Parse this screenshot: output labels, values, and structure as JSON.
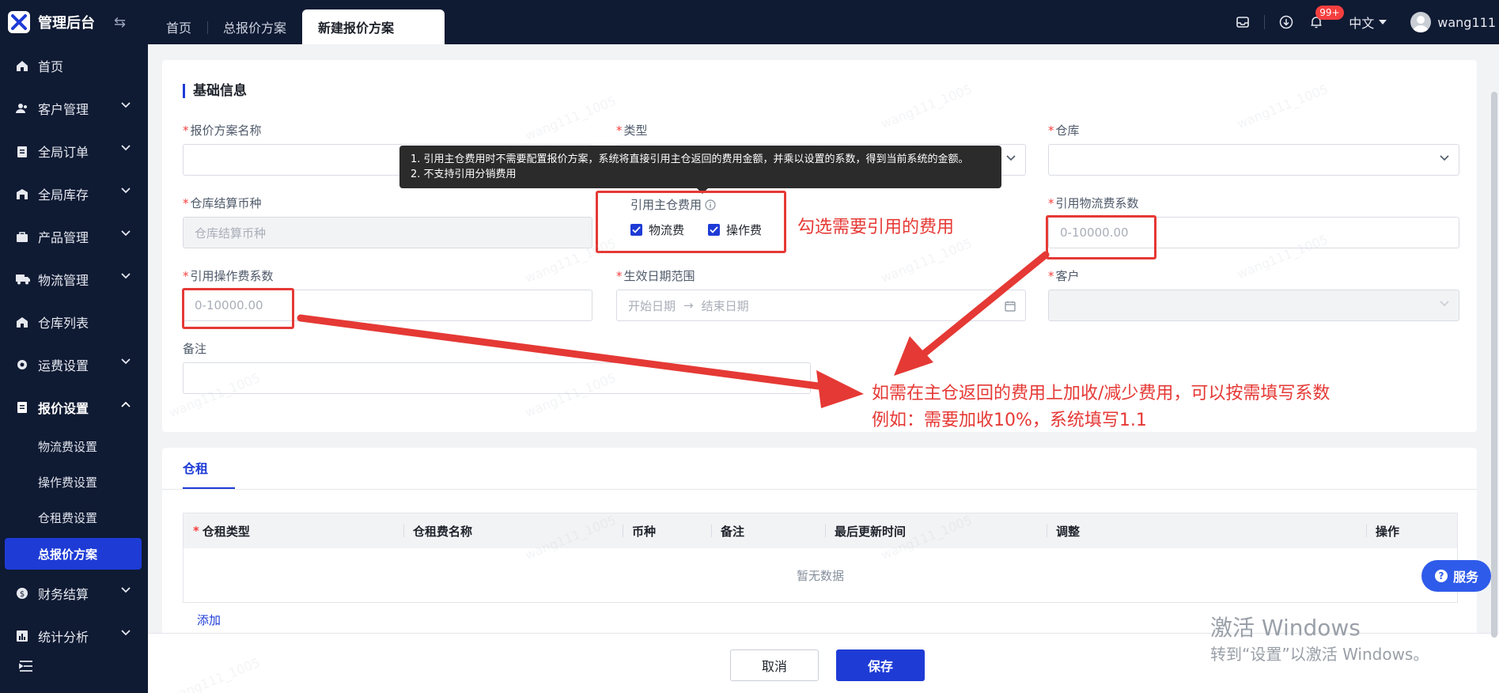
{
  "app": {
    "title": "管理后台",
    "collapse_icon": "swap-icon"
  },
  "tabs": [
    {
      "label": "首页"
    },
    {
      "label": "总报价方案"
    },
    {
      "label": "新建报价方案"
    }
  ],
  "header": {
    "notification_badge": "99+",
    "language": "中文",
    "username": "wang111"
  },
  "sidebar": {
    "items": [
      {
        "label": "首页"
      },
      {
        "label": "客户管理"
      },
      {
        "label": "全局订单"
      },
      {
        "label": "全局库存"
      },
      {
        "label": "产品管理"
      },
      {
        "label": "物流管理"
      },
      {
        "label": "仓库列表"
      },
      {
        "label": "运费设置"
      },
      {
        "label": "报价设置"
      },
      {
        "label": "财务结算"
      },
      {
        "label": "统计分析"
      }
    ],
    "sub_items": [
      {
        "label": "物流费设置"
      },
      {
        "label": "操作费设置"
      },
      {
        "label": "仓租费设置"
      },
      {
        "label": "总报价方案"
      }
    ]
  },
  "form": {
    "section_title": "基础信息",
    "required_mark": "*",
    "fields": {
      "plan_name": {
        "label": "报价方案名称",
        "value": ""
      },
      "type": {
        "label": "类型"
      },
      "warehouse": {
        "label": "仓库"
      },
      "currency": {
        "label": "仓库结算币种",
        "placeholder": "仓库结算币种"
      },
      "ref_fee": {
        "label": "引用主仓费用",
        "options": [
          "物流费",
          "操作费"
        ]
      },
      "logistics_coef": {
        "label": "引用物流费系数",
        "placeholder": "0-10000.00"
      },
      "op_coef": {
        "label": "引用操作费系数",
        "placeholder": "0-10000.00"
      },
      "date_range": {
        "label": "生效日期范围",
        "start_placeholder": "开始日期",
        "end_placeholder": "结束日期"
      },
      "customer": {
        "label": "客户"
      },
      "remark": {
        "label": "备注"
      }
    },
    "tooltip": {
      "line1": "1. 引用主仓费用时不需要配置报价方案，系统将直接引用主仓返回的费用金额，并乘以设置的系数，得到当前系统的金额。",
      "line2": "2. 不支持引用分销费用"
    }
  },
  "annotations": {
    "check_note": "勾选需要引用的费用",
    "coef_note_line1": "如需在主仓返回的费用上加收/减少费用，可以按需填写系数",
    "coef_note_line2": "例如：需要加收10%，系统填写1.1",
    "color": "#e53935"
  },
  "rent": {
    "tab": "仓租",
    "columns": [
      "仓租类型",
      "仓租费名称",
      "币种",
      "备注",
      "最后更新时间",
      "调整",
      "操作"
    ],
    "empty": "暂无数据",
    "add": "添加"
  },
  "footer": {
    "cancel": "取消",
    "save": "保存"
  },
  "service_button": "服务",
  "windows_activation": {
    "line1": "激活 Windows",
    "line2": "转到“设置”以激活 Windows。"
  },
  "watermark": "wang111_1005",
  "colors": {
    "primary": "#1e3bd6",
    "sidebar_bg": "#0f1a33",
    "danger": "#f53f3f"
  }
}
